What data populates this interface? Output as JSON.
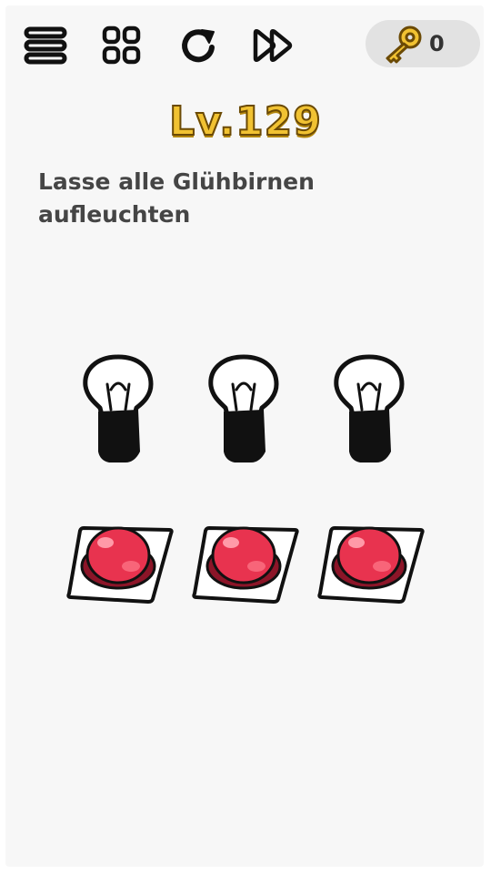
{
  "toolbar": {
    "menu_icon": "menu-icon",
    "levels_icon": "grid-icon",
    "restart_icon": "restart-icon",
    "skip_icon": "fast-forward-icon"
  },
  "keys": {
    "icon": "key-icon",
    "count": "0",
    "color": "#f1c232"
  },
  "level": {
    "label": "Lv.129"
  },
  "task": {
    "line1": "Lasse alle Glühbirnen",
    "line2": "aufleuchten"
  },
  "bulbs": [
    {
      "state": "off"
    },
    {
      "state": "off"
    },
    {
      "state": "off"
    }
  ],
  "buttons": [
    {
      "color": "#e8334f"
    },
    {
      "color": "#e8334f"
    },
    {
      "color": "#e8334f"
    }
  ]
}
